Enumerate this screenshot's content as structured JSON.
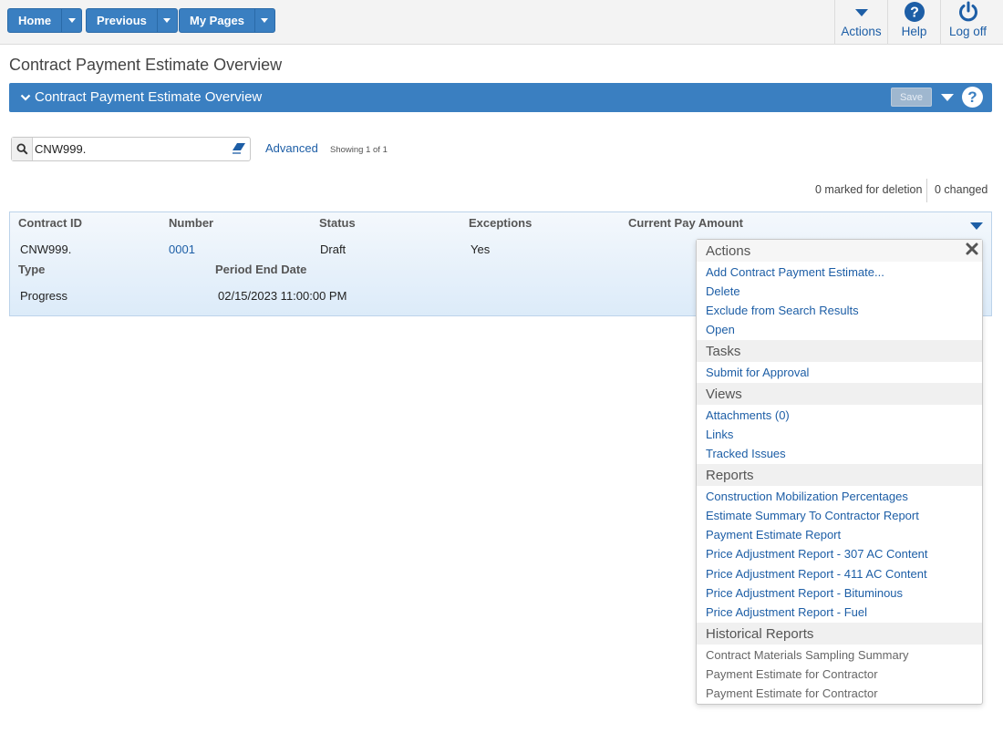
{
  "topbar": {
    "nav": [
      {
        "label": "Home"
      },
      {
        "label": "Previous"
      },
      {
        "label": "My Pages"
      }
    ],
    "actions": [
      {
        "label": "Actions",
        "icon": "chevron-down-icon"
      },
      {
        "label": "Help",
        "icon": "help-icon"
      },
      {
        "label": "Log off",
        "icon": "power-icon"
      }
    ]
  },
  "page": {
    "title": "Contract Payment Estimate Overview"
  },
  "section": {
    "title": "Contract Payment Estimate Overview",
    "save_label": "Save"
  },
  "search": {
    "value": "CNW999.",
    "advanced_label": "Advanced",
    "showing": "Showing 1 of 1"
  },
  "counts": {
    "deletion": "0 marked for deletion",
    "changed": "0 changed"
  },
  "table": {
    "headers": {
      "contract_id": "Contract ID",
      "number": "Number",
      "status": "Status",
      "exceptions": "Exceptions",
      "current_pay_amount": "Current Pay Amount",
      "type": "Type",
      "period_end_date": "Period End Date"
    },
    "row": {
      "contract_id": "CNW999.",
      "number": "0001",
      "status": "Draft",
      "exceptions": "Yes",
      "type": "Progress",
      "period_end_date": "02/15/2023 11:00:00 PM"
    }
  },
  "menu": {
    "actions_title": "Actions",
    "actions": [
      "Add Contract Payment Estimate...",
      "Delete",
      "Exclude from Search Results",
      "Open"
    ],
    "tasks_title": "Tasks",
    "tasks": [
      "Submit for Approval"
    ],
    "views_title": "Views",
    "views": [
      "Attachments (0)",
      "Links",
      "Tracked Issues"
    ],
    "reports_title": "Reports",
    "reports": [
      "Construction Mobilization Percentages",
      "Estimate Summary To Contractor Report",
      "Payment Estimate Report",
      "Price Adjustment Report - 307 AC Content",
      "Price Adjustment Report - 411 AC Content",
      "Price Adjustment Report - Bituminous",
      "Price Adjustment Report - Fuel"
    ],
    "historical_title": "Historical Reports",
    "historical": [
      "Contract Materials Sampling Summary",
      "Payment Estimate for Contractor",
      "Payment Estimate for Contractor"
    ]
  },
  "colors": {
    "primary": "#3a7fc1",
    "link": "#1d5ea6",
    "row_bg": "#dcebf9"
  }
}
